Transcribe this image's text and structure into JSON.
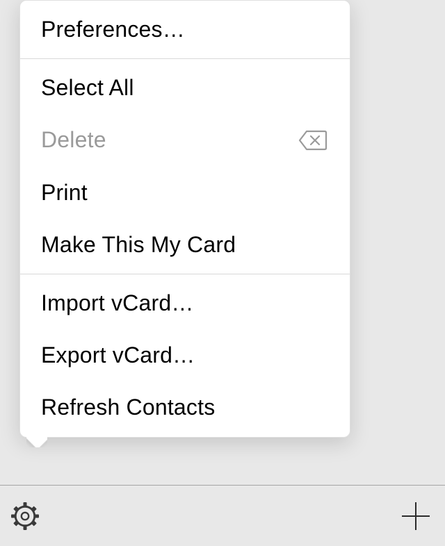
{
  "menu": {
    "sections": [
      {
        "items": [
          {
            "label": "Preferences…",
            "enabled": true,
            "icon": null
          }
        ]
      },
      {
        "items": [
          {
            "label": "Select All",
            "enabled": true,
            "icon": null
          },
          {
            "label": "Delete",
            "enabled": false,
            "icon": "delete-left-icon"
          },
          {
            "label": "Print",
            "enabled": true,
            "icon": null
          },
          {
            "label": "Make This My Card",
            "enabled": true,
            "icon": null
          }
        ]
      },
      {
        "items": [
          {
            "label": "Import vCard…",
            "enabled": true,
            "icon": null
          },
          {
            "label": "Export vCard…",
            "enabled": true,
            "icon": null
          },
          {
            "label": "Refresh Contacts",
            "enabled": true,
            "icon": null
          }
        ]
      }
    ]
  },
  "toolbar": {
    "gear": "settings",
    "plus": "add"
  }
}
